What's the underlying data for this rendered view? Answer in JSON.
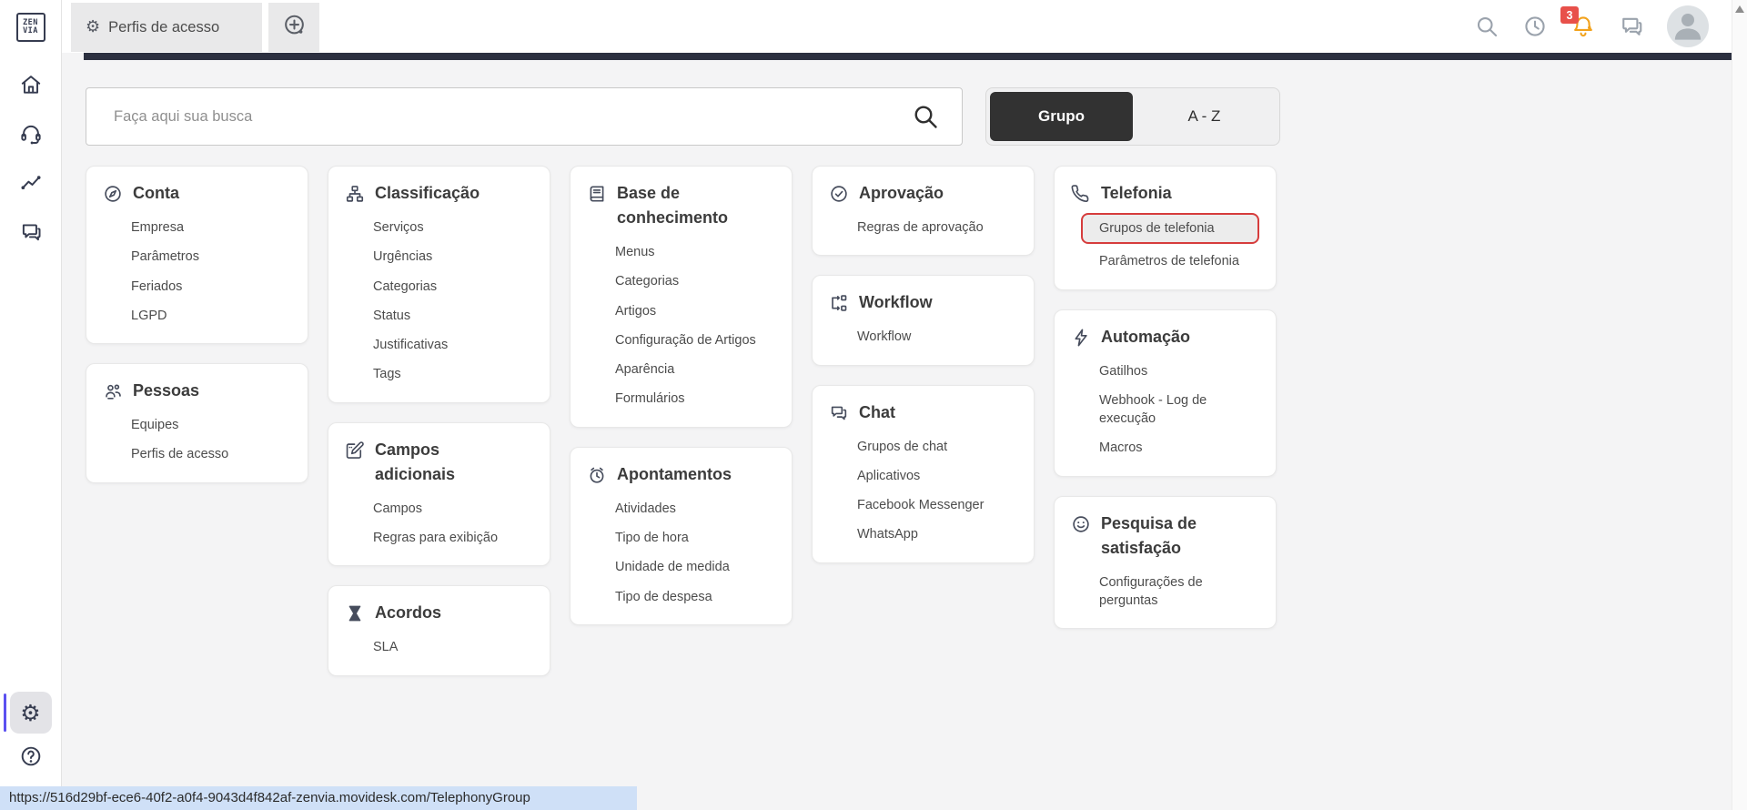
{
  "logo": {
    "line1": "ZEN",
    "line2": "VIA"
  },
  "topbar": {
    "tabs": [
      {
        "icon": "gear-icon",
        "label": "Perfis de acesso",
        "active": true
      }
    ],
    "new_tab_icon": "plus-circle-icon",
    "actions": [
      {
        "icon": "search-icon"
      },
      {
        "icon": "history-icon"
      },
      {
        "icon": "bell-icon",
        "badge": "3"
      },
      {
        "icon": "messages-icon"
      }
    ],
    "notification_badge": "3"
  },
  "sidebar": {
    "items": [
      {
        "icon": "home-icon"
      },
      {
        "icon": "headset-icon"
      },
      {
        "icon": "analytics-icon"
      },
      {
        "icon": "chat-icon"
      }
    ],
    "bottom_items": [
      {
        "icon": "gear-icon",
        "active": true
      },
      {
        "icon": "help-icon"
      }
    ]
  },
  "search": {
    "placeholder": "Faça aqui sua busca",
    "icon": "search-icon"
  },
  "view_toggle": {
    "options": [
      {
        "label": "Grupo",
        "selected": true
      },
      {
        "label": "A - Z",
        "selected": false
      }
    ]
  },
  "columns": [
    [
      {
        "icon": "compass-icon",
        "title": "Conta",
        "items": [
          {
            "label": "Empresa"
          },
          {
            "label": "Parâmetros"
          },
          {
            "label": "Feriados"
          },
          {
            "label": "LGPD"
          }
        ]
      },
      {
        "icon": "people-icon",
        "title": "Pessoas",
        "items": [
          {
            "label": "Equipes"
          },
          {
            "label": "Perfis de acesso"
          }
        ]
      }
    ],
    [
      {
        "icon": "sitemap-icon",
        "title": "Classificação",
        "items": [
          {
            "label": "Serviços"
          },
          {
            "label": "Urgências"
          },
          {
            "label": "Categorias"
          },
          {
            "label": "Status"
          },
          {
            "label": "Justificativas"
          },
          {
            "label": "Tags"
          }
        ]
      },
      {
        "icon": "edit-box-icon",
        "title": "Campos adicionais",
        "items": [
          {
            "label": "Campos"
          },
          {
            "label": "Regras para exibição"
          }
        ]
      },
      {
        "icon": "hourglass-icon",
        "title": "Acordos",
        "items": [
          {
            "label": "SLA"
          }
        ]
      }
    ],
    [
      {
        "icon": "book-icon",
        "title": "Base de conhecimento",
        "items": [
          {
            "label": "Menus"
          },
          {
            "label": "Categorias"
          },
          {
            "label": "Artigos"
          },
          {
            "label": "Configuração de Artigos"
          },
          {
            "label": "Aparência"
          },
          {
            "label": "Formulários"
          }
        ]
      },
      {
        "icon": "alarm-icon",
        "title": "Apontamentos",
        "items": [
          {
            "label": "Atividades"
          },
          {
            "label": "Tipo de hora"
          },
          {
            "label": "Unidade de medida"
          },
          {
            "label": "Tipo de despesa"
          }
        ]
      }
    ],
    [
      {
        "icon": "check-circle-icon",
        "title": "Aprovação",
        "items": [
          {
            "label": "Regras de aprovação"
          }
        ]
      },
      {
        "icon": "workflow-icon",
        "title": "Workflow",
        "items": [
          {
            "label": "Workflow"
          }
        ]
      },
      {
        "icon": "chat-double-icon",
        "title": "Chat",
        "items": [
          {
            "label": "Grupos de chat"
          },
          {
            "label": "Aplicativos"
          },
          {
            "label": "Facebook Messenger"
          },
          {
            "label": "WhatsApp"
          }
        ]
      }
    ],
    [
      {
        "icon": "phone-icon",
        "title": "Telefonia",
        "items": [
          {
            "label": "Grupos de telefonia",
            "highlighted": true
          },
          {
            "label": "Parâmetros de telefonia"
          }
        ]
      },
      {
        "icon": "lightning-icon",
        "title": "Automação",
        "items": [
          {
            "label": "Gatilhos"
          },
          {
            "label": "Webhook - Log de execução"
          },
          {
            "label": "Macros"
          }
        ]
      },
      {
        "icon": "smiley-icon",
        "title": "Pesquisa de satisfação",
        "items": [
          {
            "label": "Configurações de perguntas"
          }
        ]
      }
    ]
  ],
  "statusbar": {
    "url": "https://516d29bf-ece6-40f2-a0f4-9043d4f842af-zenvia.movidesk.com/TelephonyGroup"
  },
  "colors": {
    "accent_dark": "#2c3040",
    "sidebar_icon": "#363c50",
    "highlight_red": "#d63c3c",
    "bell_orange": "#f2a21c",
    "badge_red": "#e8504a",
    "active_purple": "#5b51f0",
    "statusbar_blue": "#cfe0f7",
    "selected_toggle": "#323232"
  }
}
